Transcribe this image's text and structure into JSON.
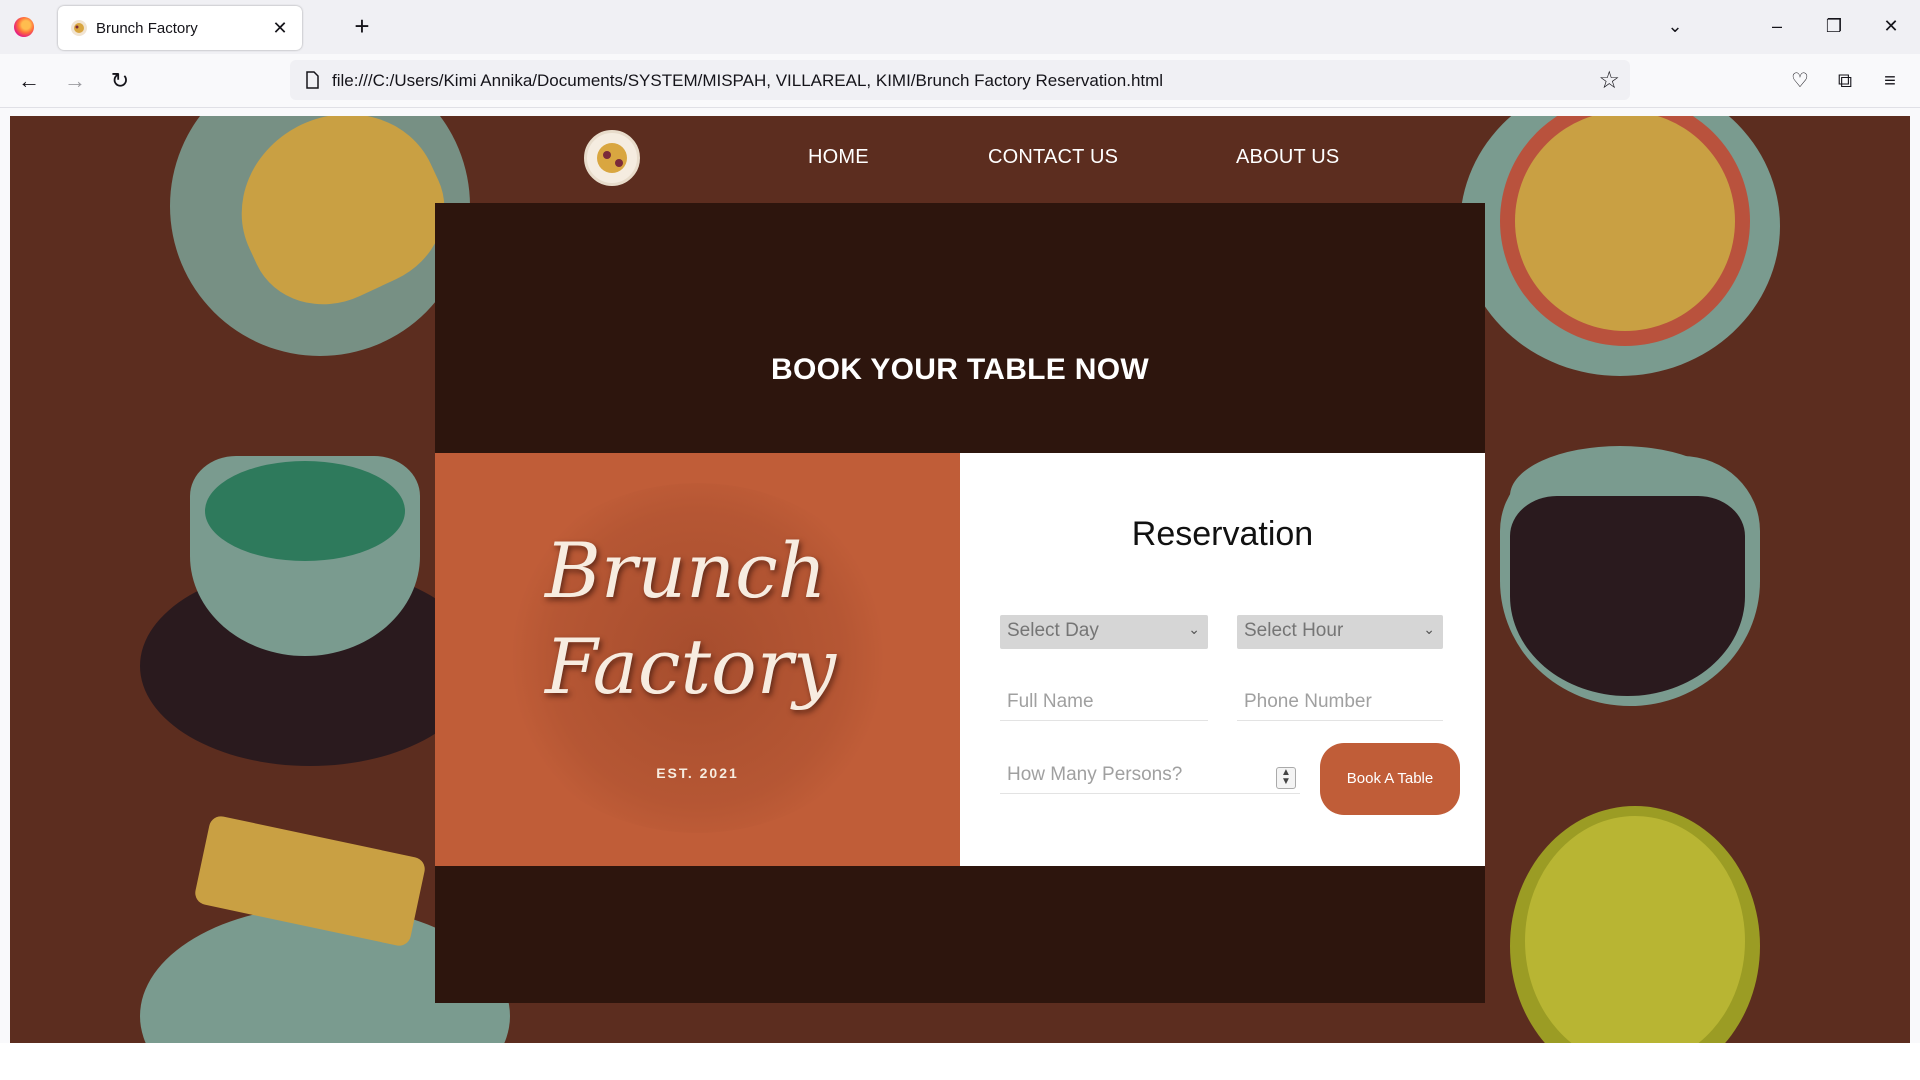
{
  "browser": {
    "tab_title": "Brunch Factory",
    "url": "file:///C:/Users/Kimi Annika/Documents/SYSTEM/MISPAH, VILLAREAL, KIMI/Brunch Factory Reservation.html"
  },
  "site": {
    "nav": {
      "home": "HOME",
      "contact": "CONTACT US",
      "about": "ABOUT US"
    },
    "headline": "BOOK YOUR TABLE NOW",
    "brand": {
      "name_line1": "Brunch",
      "name_line2": "Factory",
      "est": "EST. 2021"
    },
    "form": {
      "title": "Reservation",
      "select_day": "Select Day",
      "select_hour": "Select Hour",
      "full_name_placeholder": "Full Name",
      "phone_placeholder": "Phone Number",
      "persons_placeholder": "How Many Persons?",
      "submit_label": "Book A Table"
    }
  },
  "colors": {
    "page_bg": "#5c2d1f",
    "panel_dark": "#2d150d",
    "brand_orange": "#c05d38",
    "cream": "#f7ece0"
  }
}
